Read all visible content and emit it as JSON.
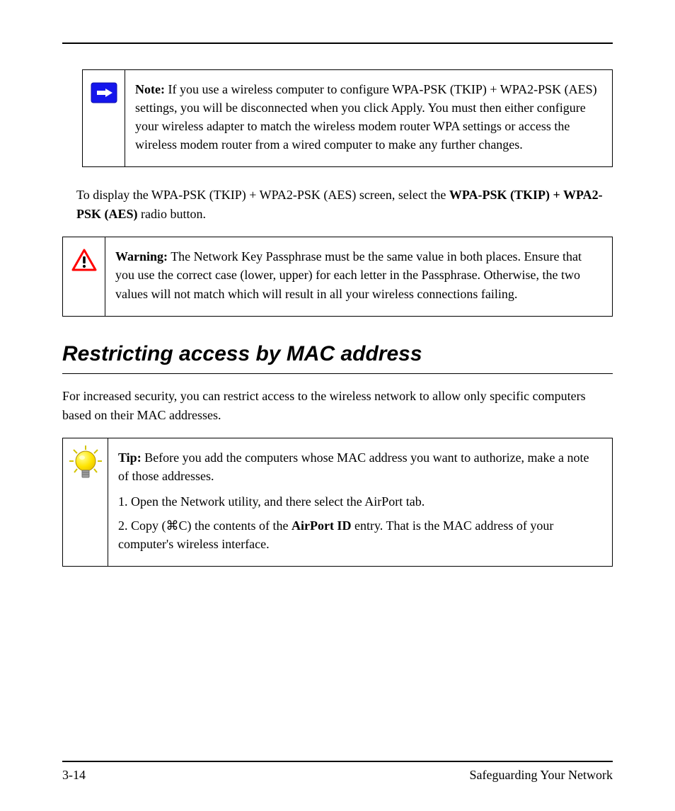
{
  "note1": {
    "label": "Note:",
    "text": " If you use a wireless computer to configure WPA-PSK (TKIP) + WPA2-PSK (AES) settings, you will be disconnected when you click Apply. You must then either configure your wireless adapter to match the wireless modem router WPA settings or access the wireless modem router from a wired computer to make any further changes."
  },
  "para1": {
    "prefix": "To display the WPA-PSK (TKIP) + WPA2-PSK (AES) screen, select the ",
    "bold": "WPA-PSK (TKIP) + WPA2-PSK (AES)",
    "suffix": " radio button."
  },
  "note2": {
    "label": "Warning:",
    "text": " The Network Key Passphrase must be the same value in both places. Ensure that you use the correct case (lower, upper) for each letter in the Passphrase. Otherwise, the two values will not match which will result in all your wireless connections failing."
  },
  "heading": "Restricting access by MAC address",
  "para2": "For increased security, you can restrict access to the wireless network to allow only specific computers based on their MAC addresses.",
  "note3": {
    "label": "Tip:",
    "text_before": " Before you add the computers whose MAC address you want to authorize, make a note of those addresses. ",
    "text_step1": "1. Open the Network utility, and there select the AirPort tab.",
    "text_step2_prefix": "2. Copy (⌘C) the contents of the ",
    "text_step2_bold": "AirPort ID",
    "text_step2_suffix": " entry. That is the MAC address of your computer's wireless interface."
  },
  "footer": {
    "page": "3-14",
    "section": "Safeguarding Your Network"
  }
}
